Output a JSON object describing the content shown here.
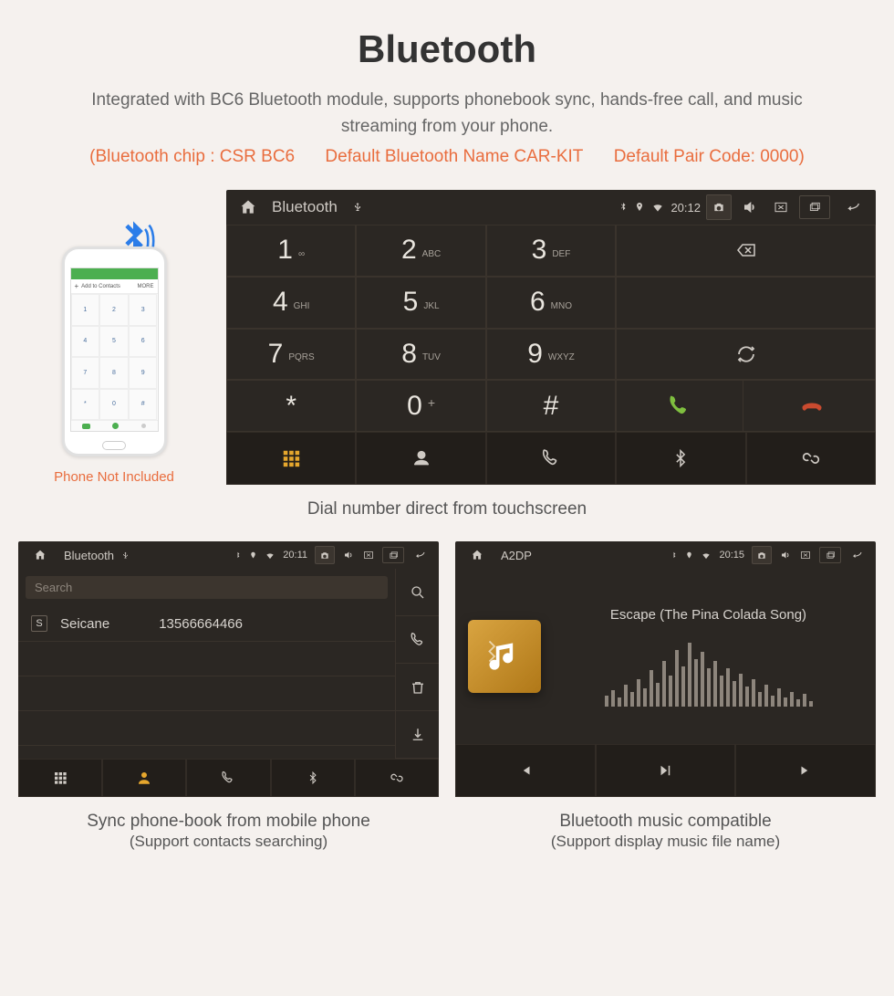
{
  "header": {
    "title": "Bluetooth",
    "subtitle": "Integrated with BC6 Bluetooth module, supports phonebook sync, hands-free call, and music streaming from your phone.",
    "spec_chip": "(Bluetooth chip : CSR BC6",
    "spec_name": "Default Bluetooth Name CAR-KIT",
    "spec_pair": "Default Pair Code: 0000)"
  },
  "phone_illustration": {
    "add_contacts": "Add to Contacts",
    "more": "MORE",
    "caption": "Phone Not Included"
  },
  "dialer": {
    "app_title": "Bluetooth",
    "time": "20:12",
    "keys": [
      {
        "n": "1",
        "l": "∞"
      },
      {
        "n": "2",
        "l": "ABC"
      },
      {
        "n": "3",
        "l": "DEF"
      },
      {
        "n": "4",
        "l": "GHI"
      },
      {
        "n": "5",
        "l": "JKL"
      },
      {
        "n": "6",
        "l": "MNO"
      },
      {
        "n": "7",
        "l": "PQRS"
      },
      {
        "n": "8",
        "l": "TUV"
      },
      {
        "n": "9",
        "l": "WXYZ"
      },
      {
        "n": "*",
        "l": ""
      },
      {
        "n": "0",
        "l": "+"
      },
      {
        "n": "#",
        "l": ""
      }
    ],
    "caption": "Dial number direct from touchscreen"
  },
  "contacts": {
    "app_title": "Bluetooth",
    "time": "20:11",
    "search_placeholder": "Search",
    "items": [
      {
        "name": "Seicane",
        "number": "13566664466"
      }
    ],
    "caption_line1": "Sync phone-book from mobile phone",
    "caption_line2": "(Support contacts searching)"
  },
  "music": {
    "app_title": "A2DP",
    "time": "20:15",
    "track": "Escape (The Pina Colada Song)",
    "caption_line1": "Bluetooth music compatible",
    "caption_line2": "(Support display music file name)"
  }
}
